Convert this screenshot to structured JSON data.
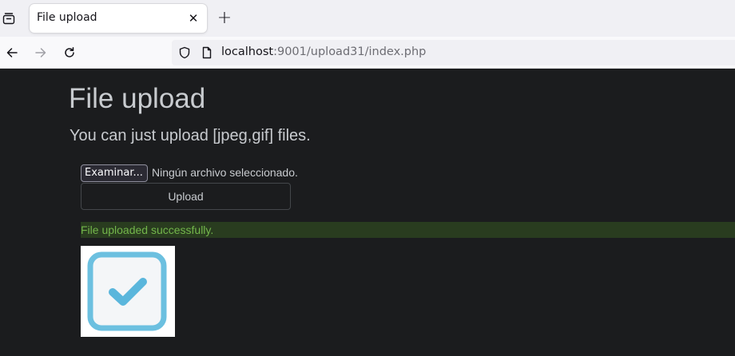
{
  "browser": {
    "tab": {
      "title": "File upload",
      "close_glyph": "✕"
    },
    "new_tab_glyph": "+",
    "url": {
      "host": "localhost",
      "rest": ":9001/upload31/index.php"
    },
    "icons": [
      "tab-list-icon",
      "back-icon",
      "forward-icon",
      "reload-icon",
      "shield-icon",
      "page-icon",
      "close-icon",
      "plus-icon"
    ]
  },
  "page": {
    "title": "File upload",
    "subtitle": "You can just upload [jpeg,gif] files.",
    "file_input": {
      "button_label": "Examinar...",
      "status": "Ningún archivo seleccionado."
    },
    "upload_label": "Upload",
    "alert": "File uploaded successfully.",
    "image": {
      "icon": "checkbox-checked-icon",
      "frame_color": "#6cc0e0",
      "check_color": "#5ab6dc"
    }
  },
  "colors": {
    "page_bg": "#1b1c1e",
    "text": "#c8cbcf",
    "alert_bg": "#293c1f",
    "alert_text": "#73b64b"
  }
}
